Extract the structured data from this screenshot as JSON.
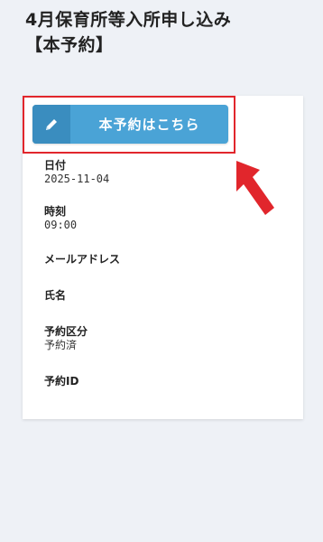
{
  "page": {
    "title_line1": "4月保育所等入所申し込み",
    "title_line2": "【本予約】"
  },
  "reserve_button": {
    "label": "本予約はこちら",
    "icon": "pencil-icon"
  },
  "fields": {
    "date": {
      "label": "日付",
      "value": "2025-11-04"
    },
    "time": {
      "label": "時刻",
      "value": "09:00"
    },
    "email": {
      "label": "メールアドレス",
      "value": ""
    },
    "name": {
      "label": "氏名",
      "value": ""
    },
    "category": {
      "label": "予約区分",
      "value": "予約済"
    },
    "reservation_id": {
      "label": "予約ID",
      "value": ""
    }
  },
  "colors": {
    "background": "#eef1f6",
    "button": "#4aa3d6",
    "button_icon_bg": "#3a8dbf",
    "highlight": "#e1262c"
  }
}
